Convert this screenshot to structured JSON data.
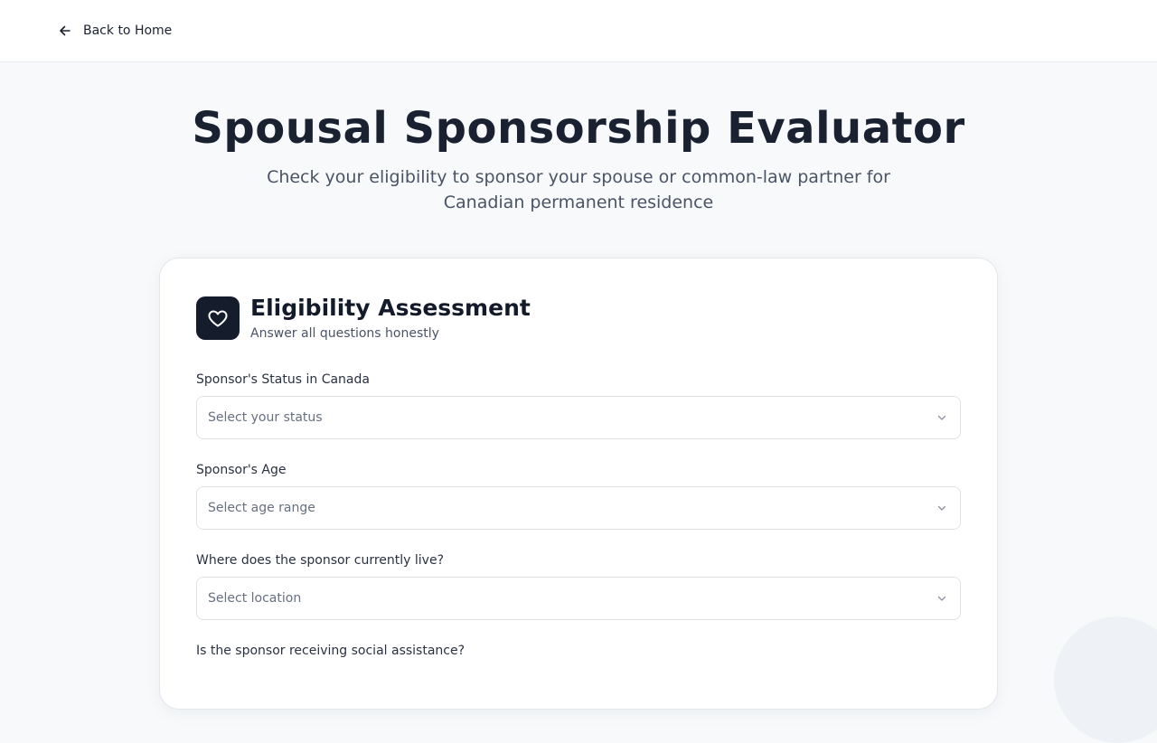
{
  "nav": {
    "back_label": "Back to Home"
  },
  "hero": {
    "title": "Spousal Sponsorship Evaluator",
    "subtitle": "Check your eligibility to sponsor your spouse or common-law partner for Canadian permanent residence"
  },
  "card": {
    "title": "Eligibility Assessment",
    "subtitle": "Answer all questions honestly",
    "icon": "heart-icon"
  },
  "fields": [
    {
      "label": "Sponsor's Status in Canada",
      "placeholder": "Select your status"
    },
    {
      "label": "Sponsor's Age",
      "placeholder": "Select age range"
    },
    {
      "label": "Where does the sponsor currently live?",
      "placeholder": "Select location"
    },
    {
      "label": "Is the sponsor receiving social assistance?"
    }
  ],
  "colors": {
    "background": "#f7f9fb",
    "accent_dark": "#151c2b",
    "text_primary": "#131a2a",
    "text_muted": "#4a5465"
  }
}
